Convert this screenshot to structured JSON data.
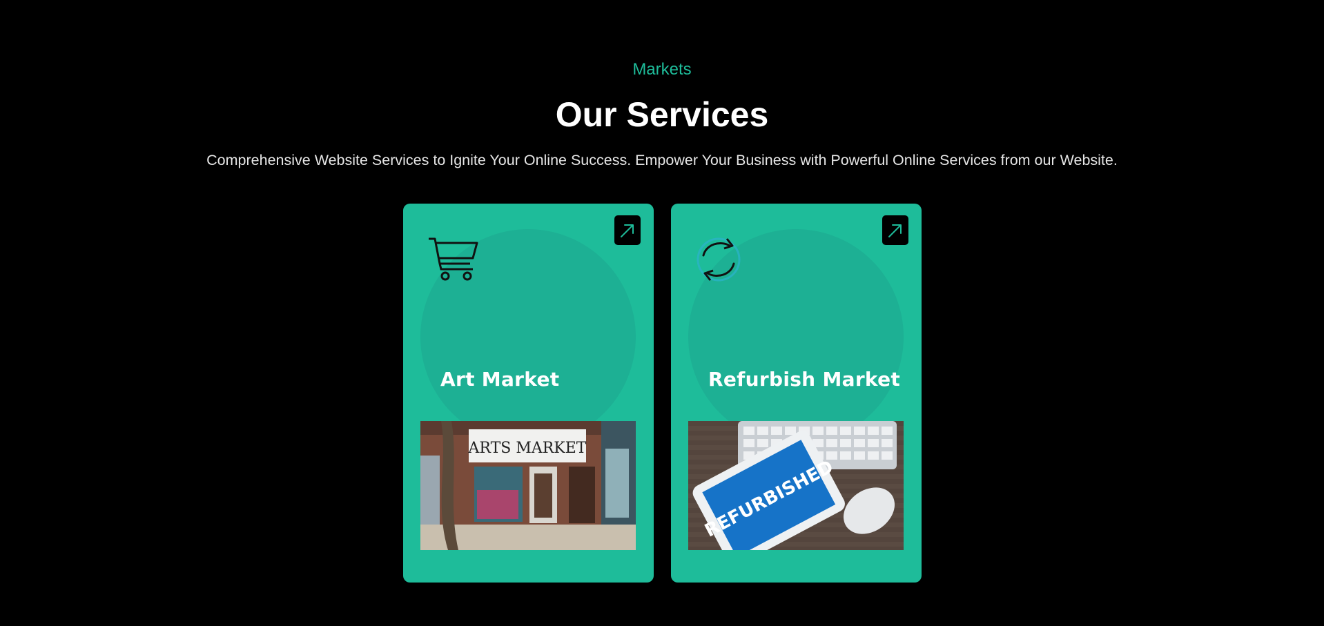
{
  "header": {
    "eyebrow": "Markets",
    "title": "Our Services",
    "subtitle": "Comprehensive Website Services to Ignite Your Online Success. Empower Your Business with Powerful Online Services from our Website."
  },
  "cards": [
    {
      "title": "Art Market",
      "icon": "shopping-cart-icon",
      "photo_sign": "ARTS MARKET"
    },
    {
      "title": "Refurbish Market",
      "icon": "refresh-cycle-icon",
      "photo_sign": "REFURBISHED"
    }
  ],
  "colors": {
    "background": "#000000",
    "accent": "#1ebc9a",
    "card": "#1ebc9a",
    "blob": "#1db094",
    "title": "#ffffff"
  }
}
